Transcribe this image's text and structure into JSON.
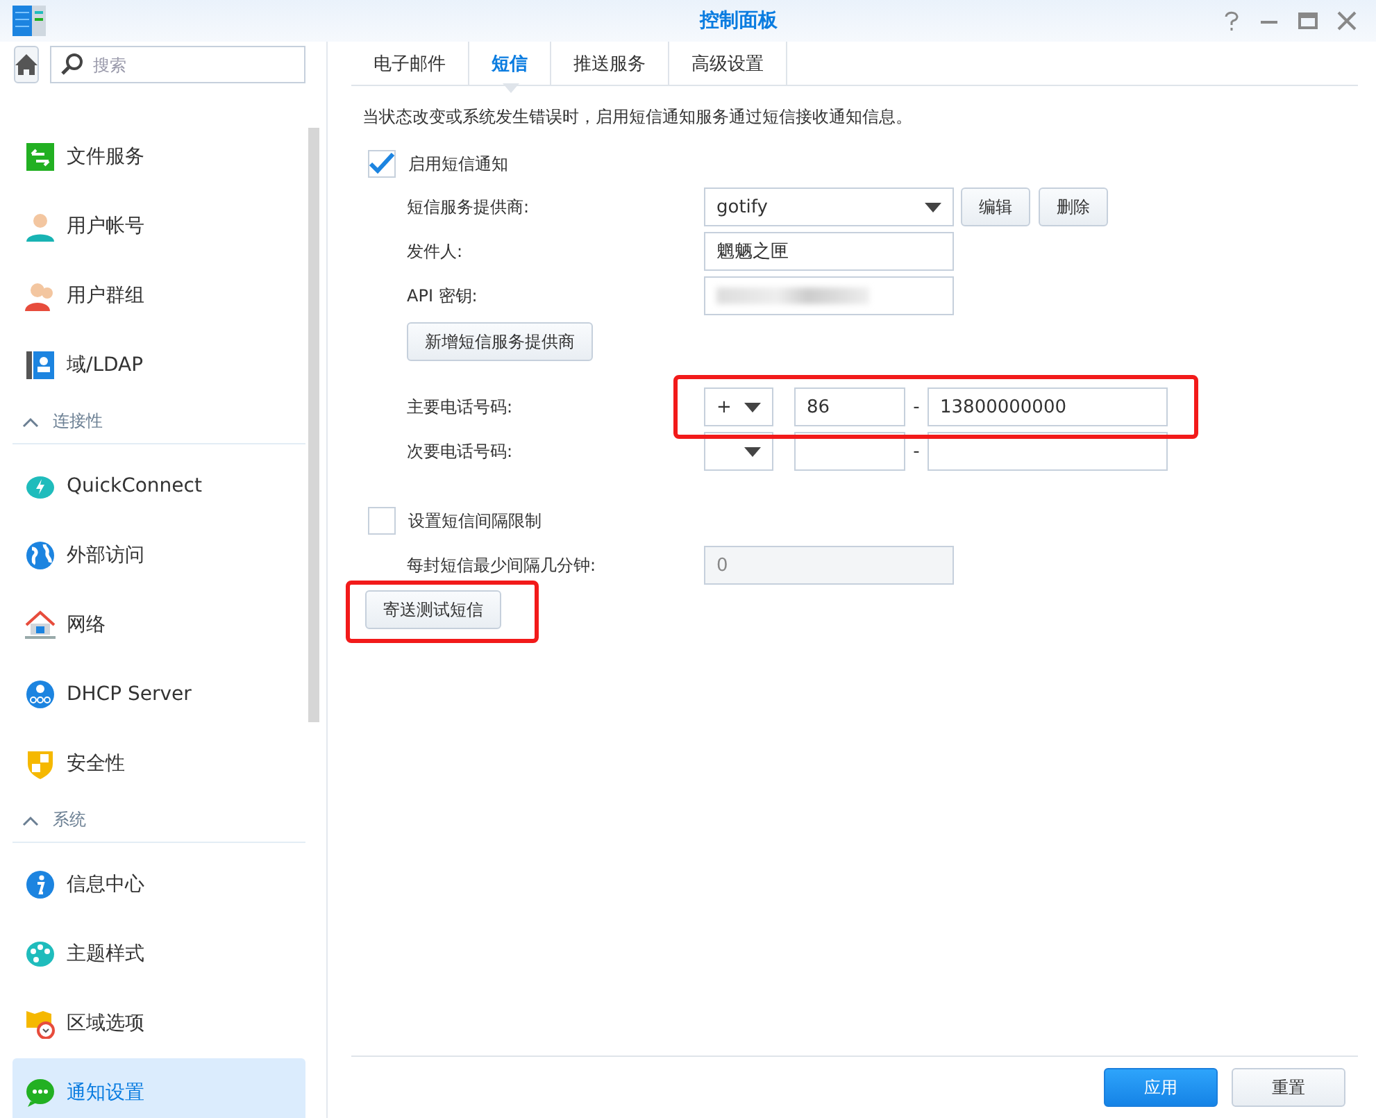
{
  "window": {
    "title": "控制面板"
  },
  "sidebar": {
    "search": {
      "placeholder": "搜索"
    },
    "items": [
      {
        "kind": "item",
        "label": "文件服务",
        "selected": false
      },
      {
        "kind": "item",
        "label": "用户帐号",
        "selected": false
      },
      {
        "kind": "item",
        "label": "用户群组",
        "selected": false
      },
      {
        "kind": "item",
        "label": "域/LDAP",
        "selected": false
      },
      {
        "kind": "section",
        "label": "连接性",
        "expanded": true
      },
      {
        "kind": "item",
        "label": "QuickConnect",
        "selected": false
      },
      {
        "kind": "item",
        "label": "外部访问",
        "selected": false
      },
      {
        "kind": "item",
        "label": "网络",
        "selected": false
      },
      {
        "kind": "item",
        "label": "DHCP Server",
        "selected": false
      },
      {
        "kind": "item",
        "label": "安全性",
        "selected": false
      },
      {
        "kind": "section",
        "label": "系统",
        "expanded": true
      },
      {
        "kind": "item",
        "label": "信息中心",
        "selected": false
      },
      {
        "kind": "item",
        "label": "主题样式",
        "selected": false
      },
      {
        "kind": "item",
        "label": "区域选项",
        "selected": false
      },
      {
        "kind": "item",
        "label": "通知设置",
        "selected": true
      }
    ]
  },
  "tabs": [
    {
      "label": "电子邮件",
      "selected": false
    },
    {
      "label": "短信",
      "selected": true
    },
    {
      "label": "推送服务",
      "selected": false
    },
    {
      "label": "高级设置",
      "selected": false
    }
  ],
  "description": "当状态改变或系统发生错误时，启用短信通知服务通过短信接收通知信息。",
  "enable_sms": {
    "label": "启用短信通知",
    "checked": true
  },
  "provider": {
    "label": "短信服务提供商:",
    "value": "gotify",
    "buttons": [
      "编辑",
      "删除"
    ]
  },
  "sender": {
    "label": "发件人:",
    "value": "魍魉之匣"
  },
  "api_key": {
    "label": "API 密钥:"
  },
  "add_provider_button": "新增短信服务提供商",
  "primary_phone": {
    "label": "主要电话号码:",
    "prefix": "+",
    "country_code": "86",
    "separator": "-",
    "number": "13800000000"
  },
  "secondary_phone": {
    "label": "次要电话号码:",
    "separator": "-"
  },
  "interval_limit": {
    "label": "设置短信间隔限制",
    "checked": false
  },
  "min_interval": {
    "label": "每封短信最少间隔几分钟:",
    "value": "0",
    "disabled": true
  },
  "test_button": "寄送测试短信",
  "footer_buttons": [
    {
      "label": "应用",
      "primary": true
    },
    {
      "label": "重置",
      "primary": false
    }
  ]
}
